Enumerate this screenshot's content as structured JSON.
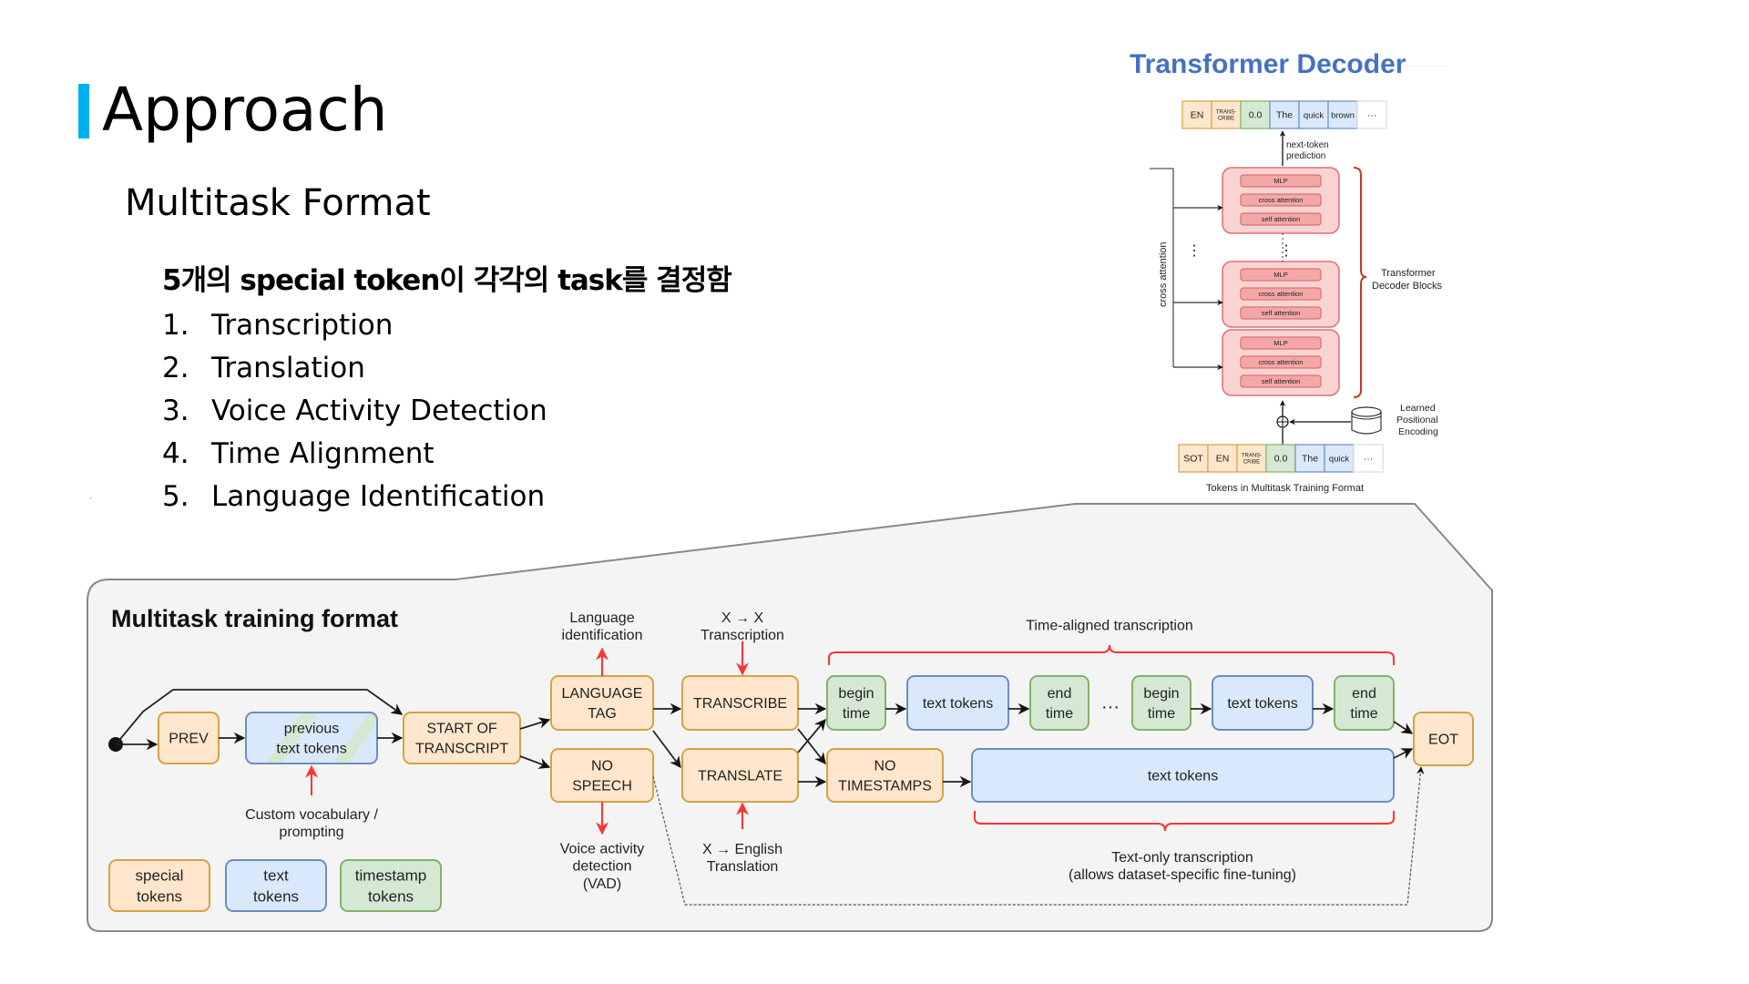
{
  "slide": {
    "title": "Approach",
    "subtitle": "Multitask Format",
    "heading": "5개의 special token이 각각의 task를 결정함",
    "list": [
      {
        "num": "1.",
        "label": "Transcription"
      },
      {
        "num": "2.",
        "label": "Translation"
      },
      {
        "num": "3.",
        "label": "Voice Activity Detection"
      },
      {
        "num": "4.",
        "label": "Time Alignment"
      },
      {
        "num": "5.",
        "label": "Language Identification"
      }
    ],
    "stray_mark": "`"
  },
  "decoder": {
    "title": "Transformer Decoder",
    "output_tokens": [
      "EN",
      "TRANS-\nCRIBE",
      "0.0",
      "The",
      "quick",
      "brown",
      "···"
    ],
    "next_token_label": [
      "next-token",
      "prediction"
    ],
    "block_layers": [
      "MLP",
      "cross attention",
      "self attention"
    ],
    "cross_attention_label": "cross attention",
    "blocks_label": [
      "Transformer",
      "Decoder Blocks"
    ],
    "positional_label": [
      "Learned",
      "Positional",
      "Encoding"
    ],
    "input_tokens": [
      "SOT",
      "EN",
      "TRANS-\nCRIBE",
      "0.0",
      "The",
      "quick",
      "···"
    ],
    "caption": "Tokens in Multitask Training Format",
    "ellipsis": "⋮"
  },
  "training": {
    "title": "Multitask training format",
    "nodes": {
      "prev": "PREV",
      "prev_text": [
        "previous",
        "text tokens"
      ],
      "start": [
        "START OF",
        "TRANSCRIPT"
      ],
      "lang_tag": [
        "LANGUAGE",
        "TAG"
      ],
      "no_speech": [
        "NO",
        "SPEECH"
      ],
      "transcribe": "TRANSCRIBE",
      "translate": "TRANSLATE",
      "begin_time": [
        "begin",
        "time"
      ],
      "text_tokens": "text tokens",
      "end_time": [
        "end",
        "time"
      ],
      "dots": "···",
      "no_timestamps": [
        "NO",
        "TIMESTAMPS"
      ],
      "eot": "EOT"
    },
    "annotations": {
      "lang_id": [
        "Language",
        "identification"
      ],
      "x_to_x": [
        "X → X",
        "Transcription"
      ],
      "custom_vocab": [
        "Custom vocabulary /",
        "prompting"
      ],
      "vad": [
        "Voice activity",
        "detection",
        "(VAD)"
      ],
      "x_to_en": [
        "X → English",
        "Translation"
      ],
      "time_aligned": "Time-aligned transcription",
      "text_only": [
        "Text-only transcription",
        "(allows dataset-specific fine-tuning)"
      ]
    },
    "legend": [
      {
        "label": [
          "special",
          "tokens"
        ],
        "kind": "special"
      },
      {
        "label": [
          "text",
          "tokens"
        ],
        "kind": "text"
      },
      {
        "label": [
          "timestamp",
          "tokens"
        ],
        "kind": "timestamp"
      }
    ]
  },
  "colors": {
    "accent_bar": "#00b0f0",
    "decoder_title": "#4472c4",
    "special_fill": "#ffe6cc",
    "special_stroke": "#d6a243",
    "text_fill": "#dae8fc",
    "text_stroke": "#6c8ebf",
    "timestamp_fill": "#d5e8d4",
    "timestamp_stroke": "#82b366",
    "block_fill": "#f8cecc",
    "block_stroke": "#e07070",
    "annotation_red": "#ff3333",
    "panel_bg": "#f4f4f4"
  }
}
